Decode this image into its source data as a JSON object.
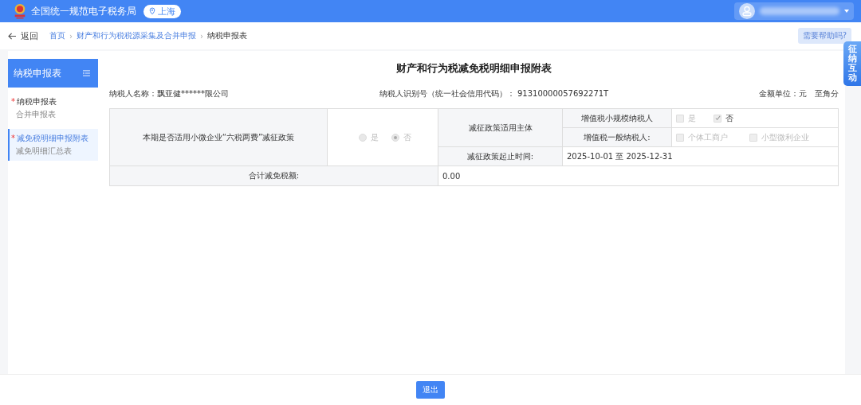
{
  "header": {
    "title": "全国统一规范电子税务局",
    "region": "上海"
  },
  "breadcrumb": {
    "back": "返回",
    "separator": "›",
    "items": [
      {
        "label": "首页",
        "link": true
      },
      {
        "label": "财产和行为税税源采集及合并申报",
        "link": true
      },
      {
        "label": "纳税申报表",
        "link": false
      }
    ]
  },
  "help": "需要帮助吗?",
  "side_tab": "征纳互动",
  "sidebar": {
    "title": "纳税申报表",
    "required_mark": "*",
    "items": [
      {
        "label": "纳税申报表",
        "sub": "合并申报表",
        "required": true,
        "selected": false
      },
      {
        "label": "减免税明细申报附表",
        "sub": "减免明细汇总表",
        "required": true,
        "selected": true
      }
    ]
  },
  "form": {
    "title": "财产和行为税减免税明细申报附表",
    "taxpayer_name": "纳税人名称：飘亚健******限公司",
    "taxpayer_id": "纳税人识别号（统一社会信用代码）： 91310000057692271T",
    "unit": "金额单位：元　至角分",
    "policy_label": "本期是否适用小微企业“六税两费”减征政策",
    "policy_options": [
      {
        "label": "是",
        "selected": false
      },
      {
        "label": "否",
        "selected": true
      }
    ],
    "subject_label": "减征政策适用主体",
    "small_scale_label": "增值税小规模纳税人",
    "small_scale_options": [
      {
        "label": "是",
        "checked": false
      },
      {
        "label": "否",
        "checked": true
      }
    ],
    "general_label": "增值税一般纳税人:",
    "general_options": [
      {
        "label": "个体工商户",
        "checked": false
      },
      {
        "label": "小型微利企业",
        "checked": false
      }
    ],
    "period_label": "减征政策起止时间:",
    "period_value": "2025-10-01 至 2025-12-31",
    "total_label": "合计减免税额:",
    "total_value": "0.00"
  },
  "footer_button": "退出"
}
